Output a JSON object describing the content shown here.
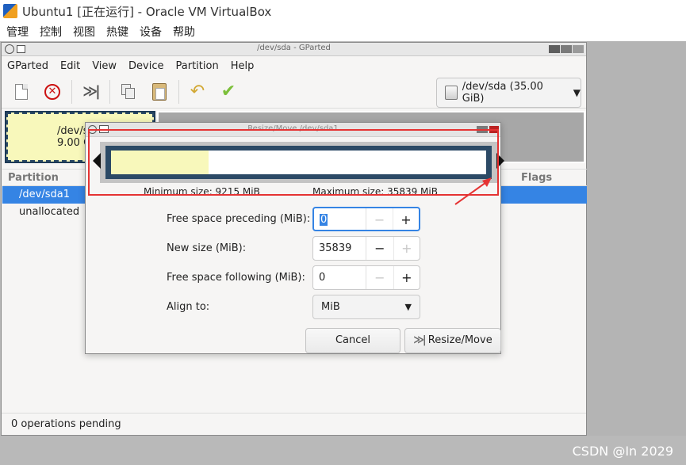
{
  "vbox": {
    "title": "Ubuntu1 [正在运行] - Oracle VM VirtualBox",
    "menu": [
      "管理",
      "控制",
      "视图",
      "热键",
      "设备",
      "帮助"
    ]
  },
  "gparted": {
    "window_title": "/dev/sda - GParted",
    "menu": [
      "GParted",
      "Edit",
      "View",
      "Device",
      "Partition",
      "Help"
    ],
    "toolbar": {
      "new_icon": "new-partition-icon",
      "delete_icon": "delete-icon",
      "resize_icon": "resize-move-icon",
      "copy_icon": "copy-icon",
      "paste_icon": "paste-icon",
      "undo_icon": "undo-icon",
      "apply_icon": "apply-icon"
    },
    "device_selector": "/dev/sda (35.00 GiB)",
    "partition_map": {
      "sda1_line1": "/dev/s",
      "sda1_line2": "9.00 G"
    },
    "table": {
      "headers": {
        "partition": "Partition",
        "flags": "Flags"
      },
      "rows": [
        {
          "partition": "/dev/sda1",
          "selected": true
        },
        {
          "partition": "unallocated",
          "selected": false
        }
      ]
    },
    "status": "0 operations pending"
  },
  "dialog": {
    "title": "Resize/Move /dev/sda1",
    "used_fraction": 0.26,
    "min_size": "Minimum size: 9215 MiB",
    "max_size": "Maximum size: 35839 MiB",
    "fields": {
      "free_preceding": {
        "label": "Free space preceding (MiB):",
        "value": "0"
      },
      "new_size": {
        "label": "New size (MiB):",
        "value": "35839"
      },
      "free_following": {
        "label": "Free space following (MiB):",
        "value": "0"
      },
      "align_to": {
        "label": "Align to:",
        "value": "MiB"
      }
    },
    "buttons": {
      "cancel": "Cancel",
      "resize": "Resize/Move"
    },
    "spin_minus": "−",
    "spin_plus": "+"
  },
  "watermark": "CSDN @In 2029",
  "colors": {
    "selection": "#3584e4",
    "used_space": "#f8f8bb",
    "partition_border": "#2c4a66",
    "annotation": "#e53333"
  }
}
